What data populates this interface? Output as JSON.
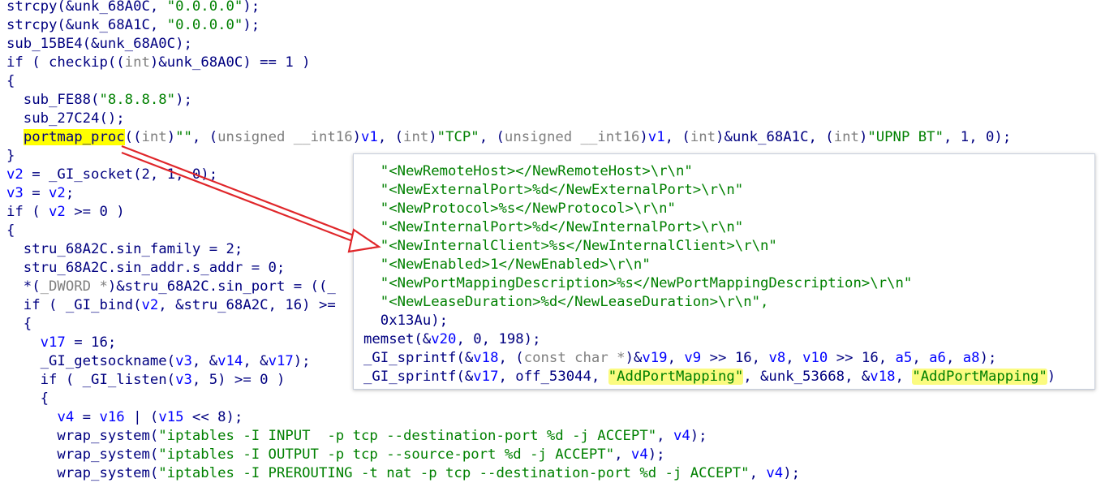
{
  "code": {
    "l0": {
      "a": "strcpy(&unk_68A0C, ",
      "s": "\"0.0.0.0\"",
      "b": ");"
    },
    "l1": {
      "a": "strcpy(&unk_68A1C, ",
      "s": "\"0.0.0.0\"",
      "b": ");"
    },
    "l2": {
      "a": "sub_15BE4(&unk_68A0C);"
    },
    "l3": {
      "a": "if ( checkip((",
      "t": "int",
      "b": ")&unk_68A0C) == 1 )"
    },
    "l4": {
      "a": "{"
    },
    "l5": {
      "a": "  sub_FE88(",
      "s": "\"8.8.8.8\"",
      "b": ");"
    },
    "l6": {
      "a": "  sub_27C24();"
    },
    "l7": {
      "ind": "  ",
      "fn": "portmap_proc",
      "p1": "((",
      "t1": "int",
      "p2": ")",
      "s1": "\"\"",
      "p3": ", (",
      "t2": "unsigned __int16",
      "p4": ")",
      "v1": "v1",
      "p5": ", (",
      "t3": "int",
      "p6": ")",
      "s2": "\"TCP\"",
      "p7": ", (",
      "t4": "unsigned __int16",
      "p8": ")",
      "v2": "v1",
      "p9": ", (",
      "t5": "int",
      "p10": ")&unk_68A1C, (",
      "t6": "int",
      "p11": ")",
      "s3": "\"UPNP BT\"",
      "p12": ", 1, 0);"
    },
    "l8": {
      "a": "}"
    },
    "l9": {
      "v": "v2",
      "b": " = _GI_socket(2, 1, 0);"
    },
    "l10": {
      "v": "v3",
      "m": " = ",
      "v2": "v2",
      "b": ";"
    },
    "l11": {
      "a": "if ( ",
      "v": "v2",
      "b": " >= 0 )"
    },
    "l12": {
      "a": "{"
    },
    "l13": {
      "a": "  stru_68A2C.sin_family = 2;"
    },
    "l14": {
      "a": "  stru_68A2C.sin_addr.s_addr = 0;"
    },
    "l15": {
      "a": "  *(",
      "t": "_DWORD *",
      "b": ")&stru_68A2C.sin_port = ((_"
    },
    "l16": {
      "a": "  if ( _GI_bind(",
      "v": "v2",
      "b": ", &stru_68A2C, 16) >="
    },
    "l17": {
      "a": "  {"
    },
    "l18": {
      "ind": "    ",
      "v": "v17",
      "b": " = 16;"
    },
    "l19": {
      "a": "    _GI_getsockname(",
      "v1": "v3",
      "m": ", &",
      "v2": "v14",
      "m2": ", &",
      "v3": "v17",
      "b": ");"
    },
    "l20": {
      "a": "    if ( _GI_listen(",
      "v": "v3",
      "b": ", 5) >= 0 )"
    },
    "l21": {
      "a": "    {"
    },
    "l22": {
      "ind": "      ",
      "v1": "v4",
      "m": " = ",
      "v2": "v16",
      "m2": " | (",
      "v3": "v15",
      "b": " << 8);"
    },
    "l23": {
      "a": "      wrap_system(",
      "s": "\"iptables -I INPUT  -p tcp --destination-port %d -j ACCEPT\"",
      "m": ", ",
      "v": "v4",
      "b": ");"
    },
    "l24": {
      "a": "      wrap_system(",
      "s": "\"iptables -I OUTPUT -p tcp --source-port %d -j ACCEPT\"",
      "m": ", ",
      "v": "v4",
      "b": ");"
    },
    "l25": {
      "a": "      wrap_system(",
      "s": "\"iptables -I PREROUTING -t nat -p tcp --destination-port %d -j ACCEPT\"",
      "m": ", ",
      "v": "v4",
      "b": ");"
    }
  },
  "popup": {
    "p0": {
      "a": "  \"<NewRemoteHost></NewRemoteHost>\\r\\n\""
    },
    "p1": {
      "a": "  \"<NewExternalPort>%d</NewExternalPort>\\r\\n\""
    },
    "p2": {
      "a": "  \"<NewProtocol>%s</NewProtocol>\\r\\n\""
    },
    "p3": {
      "a": "  \"<NewInternalPort>%d</NewInternalPort>\\r\\n\""
    },
    "p4": {
      "a": "  \"<NewInternalClient>%s</NewInternalClient>\\r\\n\""
    },
    "p5": {
      "a": "  \"<NewEnabled>1</NewEnabled>\\r\\n\""
    },
    "p6": {
      "a": "  \"<NewPortMappingDescription>%s</NewPortMappingDescription>\\r\\n\""
    },
    "p7": {
      "a": "  \"<NewLeaseDuration>%d</NewLeaseDuration>\\r\\n\","
    },
    "p8": {
      "a": "  0x13Au);"
    },
    "p9": {
      "a": "memset(&",
      "v": "v20",
      "b": ", 0, 198);"
    },
    "p10": {
      "a": "_GI_sprintf(&",
      "v1": "v18",
      "m1": ", (",
      "t": "const char *",
      "m2": ")&",
      "v2": "v19",
      "m3": ", ",
      "v3": "v9",
      "m4": " >> 16, ",
      "v4": "v8",
      "m5": ", ",
      "v5": "v10",
      "m6": " >> 16, ",
      "v6": "a5",
      "m7": ", ",
      "v7": "a6",
      "m8": ", ",
      "v8": "a8",
      "b": ");"
    },
    "p11": {
      "a": "_GI_sprintf(&",
      "v1": "v17",
      "m1": ", off_53044, ",
      "s1": "\"AddPortMapping\"",
      "m2": ", &unk_53668, &",
      "v2": "v18",
      "m3": ", ",
      "s2": "\"AddPortMapping\"",
      "b": ")"
    }
  }
}
